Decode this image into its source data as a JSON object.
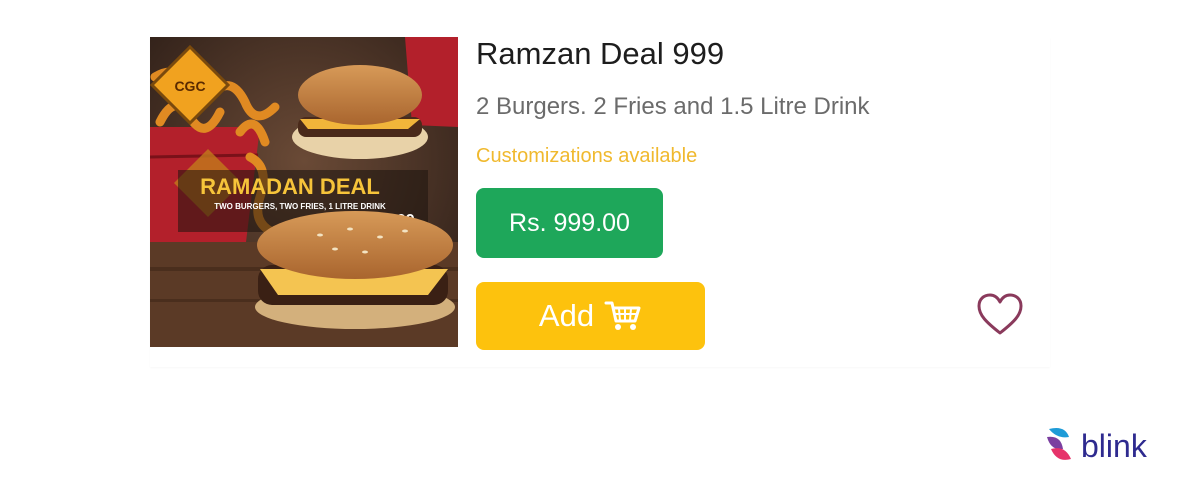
{
  "deal": {
    "title": "Ramzan Deal 999",
    "description": "2 Burgers. 2 Fries and 1.5 Litre Drink",
    "customizations": "Customizations available",
    "price": "Rs. 999.00",
    "add_label": "Add"
  },
  "image": {
    "badge_text": "CGC",
    "banner_title": "RAMADAN DEAL",
    "banner_subtitle": "TWO BURGERS, TWO FRIES, 1 LITRE DRINK",
    "banner_price": "RS.999"
  },
  "brand": {
    "name": "blink"
  },
  "colors": {
    "price_badge": "#1ea75a",
    "add_button": "#fdc20d",
    "customizations_text": "#f0b92e",
    "heart_outline": "#8a3a5c",
    "brand_text": "#2e2a8f"
  },
  "icons": {
    "cart": "cart-icon",
    "favorite": "heart-icon",
    "logo": "blink-logo-icon"
  }
}
